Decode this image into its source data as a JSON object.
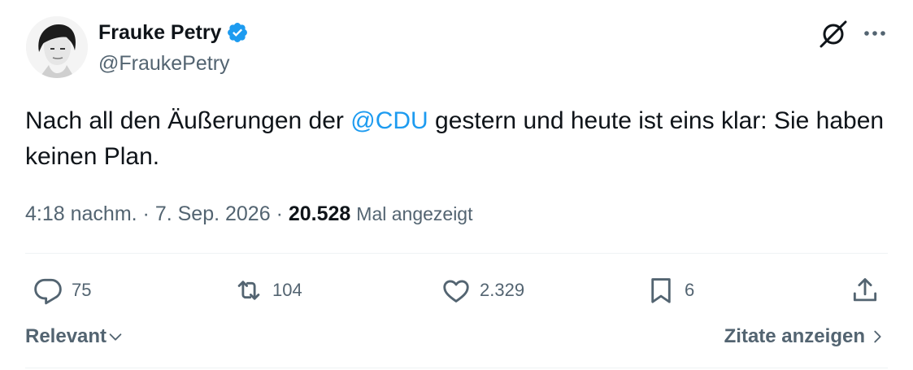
{
  "author": {
    "name": "Frauke Petry",
    "handle": "@FraukePetry",
    "verified": true
  },
  "tweet": {
    "text_before": "Nach all den Äußerungen der ",
    "mention": "@CDU",
    "text_after": " gestern und heute ist eins klar: Sie haben keinen Plan."
  },
  "meta": {
    "time": "4:18 nachm.",
    "separator": "·",
    "date": "7. Sep. 2026",
    "views": "20.528",
    "views_label": "Mal angezeigt"
  },
  "actions": {
    "replies": "75",
    "retweets": "104",
    "likes": "2.329",
    "bookmarks": "6"
  },
  "footer": {
    "sort_label": "Relevant",
    "quotes_label": "Zitate anzeigen"
  },
  "colors": {
    "accent": "#1d9bf0",
    "text": "#0f1419",
    "muted": "#536471"
  },
  "icons": [
    "verified-badge-icon",
    "grok-icon",
    "more-icon",
    "reply-icon",
    "retweet-icon",
    "like-icon",
    "bookmark-icon",
    "share-icon",
    "chevron-down-icon",
    "chevron-right-icon"
  ]
}
